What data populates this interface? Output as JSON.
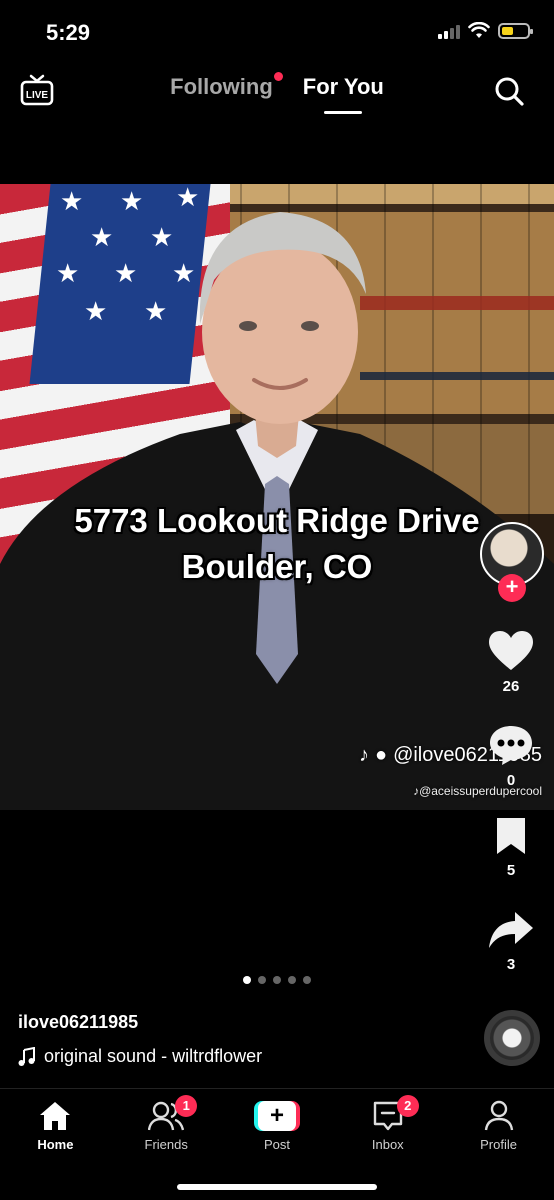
{
  "status_bar": {
    "time": "5:29",
    "battery_level": 0.45,
    "battery_color": "#f6d31b"
  },
  "top_nav": {
    "live_icon": "live-tv-icon",
    "tabs": [
      {
        "label": "Following",
        "has_dot": true,
        "active": false
      },
      {
        "label": "For You",
        "active": true
      }
    ],
    "search_icon": "search-icon"
  },
  "video": {
    "caption_line1": "5773 Lookout Ridge Drive",
    "caption_line2": "Boulder, CO",
    "watermark_handle": "@ilove06211985",
    "watermark_sub": "@aceissuperdupercool"
  },
  "actions": {
    "likes": "26",
    "comments": "0",
    "bookmarks": "5",
    "shares": "3",
    "follow_symbol": "+"
  },
  "carousel": {
    "total": 5,
    "active_index": 0
  },
  "post_info": {
    "username": "ilove06211985",
    "sound": "original sound - wiltrdflower"
  },
  "bottom_nav": {
    "items": [
      {
        "label": "Home",
        "icon": "home-icon",
        "active": true
      },
      {
        "label": "Friends",
        "icon": "friends-icon",
        "badge": "1"
      },
      {
        "label": "Post",
        "icon": "post-plus-icon"
      },
      {
        "label": "Inbox",
        "icon": "inbox-icon",
        "badge": "2"
      },
      {
        "label": "Profile",
        "icon": "profile-icon"
      }
    ]
  },
  "colors": {
    "accent": "#fe2c55",
    "cyan": "#25f4ee",
    "background": "#000000"
  }
}
